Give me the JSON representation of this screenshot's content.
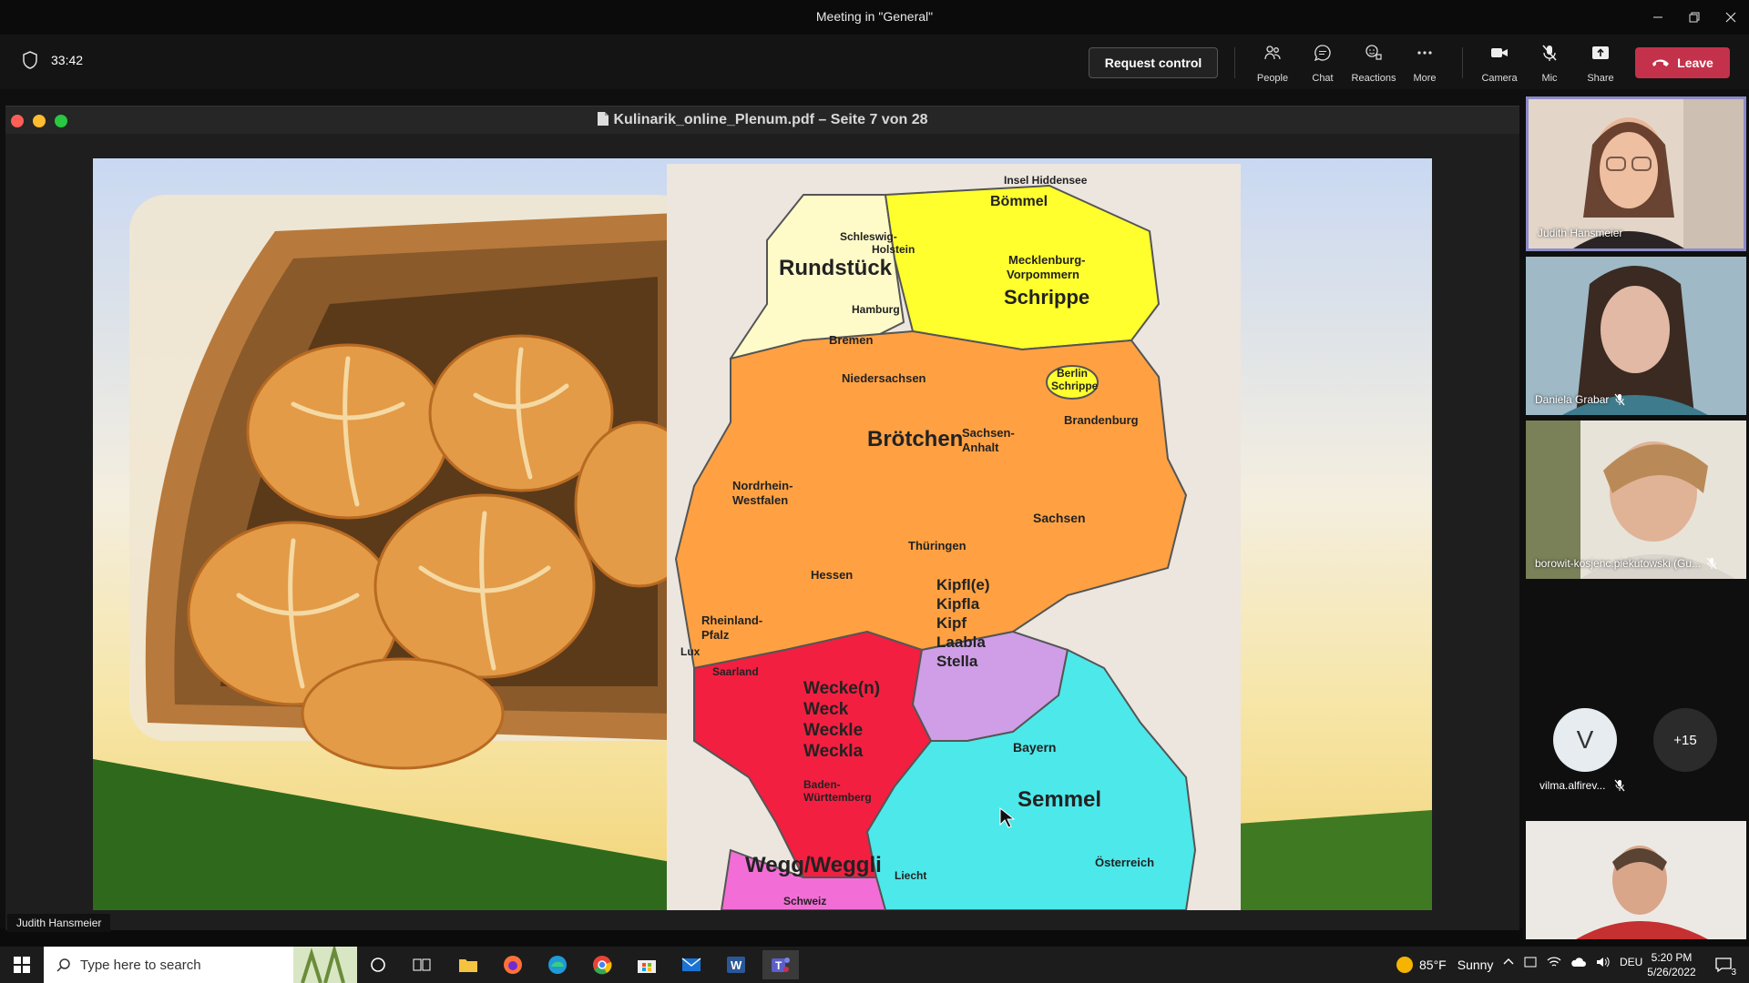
{
  "window": {
    "title": "Meeting in \"General\""
  },
  "toolbar": {
    "timer": "33:42",
    "request_control": "Request control",
    "people": "People",
    "chat": "Chat",
    "reactions": "Reactions",
    "more": "More",
    "camera": "Camera",
    "mic": "Mic",
    "share": "Share",
    "leave": "Leave"
  },
  "pdf": {
    "title": "Kulinarik_online_Plenum.pdf – Seite 7 von 28"
  },
  "map": {
    "labels": {
      "insel": "Insel Hiddensee",
      "boemmel": "Bömmel",
      "schleswig": "Schleswig-\nHolstein",
      "rundstueck": "Rundstück",
      "mecklenburg": "Mecklenburg-\nVorpommern",
      "schrippe": "Schrippe",
      "hamburg": "Hamburg",
      "bremen": "Bremen",
      "niedersachsen": "Niedersachsen",
      "berlin": "Berlin\nSchrippe",
      "brandenburg": "Brandenburg",
      "broetchen": "Brötchen",
      "sachsen_anhalt": "Sachsen-\nAnhalt",
      "nrw": "Nordrhein-\nWestfalen",
      "sachsen": "Sachsen",
      "thueringen": "Thüringen",
      "hessen": "Hessen",
      "kipfl": "Kipfl(e)\nKipfla\nKipf\nLaabla\nStella",
      "rheinland": "Rheinland-\nPfalz",
      "lux": "Lux",
      "saarland": "Saarland",
      "wecke": "Wecke(n)\nWeck\nWeckle\nWeckla",
      "bayern": "Bayern",
      "bw": "Baden-\nWürttemberg",
      "semmel": "Semmel",
      "wegg": "Wegg/Weggli",
      "liecht": "Liecht",
      "oesterreich": "Österreich",
      "schweiz": "Schweiz"
    }
  },
  "presenter_label": "Judith Hansmeier",
  "participants": [
    {
      "name": "Judith Hansmeier",
      "muted": false
    },
    {
      "name": "Daniela Grabar",
      "muted": true
    },
    {
      "name": "borowit-kosjenc.piekutowski (Gu...",
      "muted": true
    }
  ],
  "small_participant": {
    "initial": "V",
    "name": "vilma.alfirev...",
    "muted": true
  },
  "overflow_count": "+15",
  "taskbar": {
    "search_placeholder": "Type here to search",
    "weather_temp": "85°F",
    "weather_text": "Sunny",
    "language": "DEU",
    "time": "5:20 PM",
    "date": "5/26/2022",
    "notifications": "3"
  },
  "colors": {
    "leave": "#c4314b",
    "active_speaker_border": "#8b8cc7"
  }
}
